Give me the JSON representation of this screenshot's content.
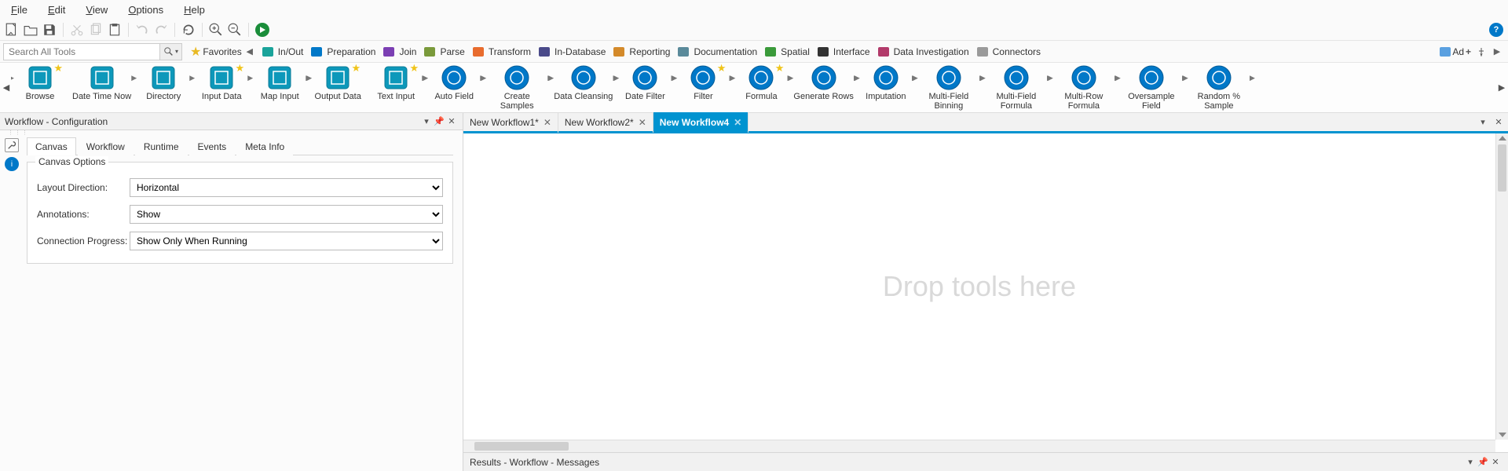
{
  "menu": {
    "items": [
      "File",
      "Edit",
      "View",
      "Options",
      "Help"
    ]
  },
  "search": {
    "placeholder": "Search All Tools"
  },
  "favorites_label": "Favorites",
  "categories": [
    {
      "name": "In/Out",
      "color": "#1aa39a"
    },
    {
      "name": "Preparation",
      "color": "#0078c8"
    },
    {
      "name": "Join",
      "color": "#7b3fb3"
    },
    {
      "name": "Parse",
      "color": "#7a9a3b"
    },
    {
      "name": "Transform",
      "color": "#e86c2e"
    },
    {
      "name": "In-Database",
      "color": "#4a4a8a"
    },
    {
      "name": "Reporting",
      "color": "#d48a2a"
    },
    {
      "name": "Documentation",
      "color": "#5a8a9a"
    },
    {
      "name": "Spatial",
      "color": "#3a9a3a"
    },
    {
      "name": "Interface",
      "color": "#333333"
    },
    {
      "name": "Data Investigation",
      "color": "#b23a6a"
    },
    {
      "name": "Connectors",
      "color": "#9a9a9a"
    }
  ],
  "add_label": "Ad",
  "tools": [
    {
      "name": "Browse",
      "shape": "square",
      "fav": true,
      "in": true,
      "out": false
    },
    {
      "name": "Date Time Now",
      "shape": "square",
      "fav": false,
      "in": false,
      "out": true
    },
    {
      "name": "Directory",
      "shape": "square",
      "fav": false,
      "in": false,
      "out": true
    },
    {
      "name": "Input Data",
      "shape": "square",
      "fav": true,
      "in": false,
      "out": true
    },
    {
      "name": "Map Input",
      "shape": "square",
      "fav": false,
      "in": false,
      "out": true
    },
    {
      "name": "Output Data",
      "shape": "square",
      "fav": true,
      "in": true,
      "out": false
    },
    {
      "name": "Text Input",
      "shape": "square",
      "fav": true,
      "in": false,
      "out": true
    },
    {
      "name": "Auto Field",
      "shape": "circle",
      "fav": false,
      "in": true,
      "out": true
    },
    {
      "name": "Create Samples",
      "shape": "circle",
      "fav": false,
      "in": true,
      "out": true
    },
    {
      "name": "Data Cleansing",
      "shape": "circle",
      "fav": false,
      "in": true,
      "out": true
    },
    {
      "name": "Date Filter",
      "shape": "circle",
      "fav": false,
      "in": true,
      "out": true
    },
    {
      "name": "Filter",
      "shape": "circle",
      "fav": true,
      "in": true,
      "out": true
    },
    {
      "name": "Formula",
      "shape": "circle",
      "fav": true,
      "in": true,
      "out": true
    },
    {
      "name": "Generate Rows",
      "shape": "circle",
      "fav": false,
      "in": true,
      "out": true
    },
    {
      "name": "Imputation",
      "shape": "circle",
      "fav": false,
      "in": true,
      "out": true
    },
    {
      "name": "Multi-Field Binning",
      "shape": "circle",
      "fav": false,
      "in": true,
      "out": true
    },
    {
      "name": "Multi-Field Formula",
      "shape": "circle",
      "fav": false,
      "in": true,
      "out": true
    },
    {
      "name": "Multi-Row Formula",
      "shape": "circle",
      "fav": false,
      "in": true,
      "out": true
    },
    {
      "name": "Oversample Field",
      "shape": "circle",
      "fav": false,
      "in": true,
      "out": true
    },
    {
      "name": "Random % Sample",
      "shape": "circle",
      "fav": false,
      "in": true,
      "out": true
    }
  ],
  "config_panel": {
    "title": "Workflow - Configuration",
    "tabs": [
      "Canvas",
      "Workflow",
      "Runtime",
      "Events",
      "Meta Info"
    ],
    "active_tab": 0,
    "legend": "Canvas Options",
    "rows": {
      "layout_label": "Layout Direction:",
      "layout_value": "Horizontal",
      "annotations_label": "Annotations:",
      "annotations_value": "Show",
      "connprog_label": "Connection Progress:",
      "connprog_value": "Show Only When Running"
    }
  },
  "doc_tabs": [
    {
      "label": "New Workflow1*",
      "active": false
    },
    {
      "label": "New Workflow2*",
      "active": false
    },
    {
      "label": "New Workflow4",
      "active": true
    }
  ],
  "canvas_hint": "Drop tools here",
  "results_title": "Results - Workflow - Messages"
}
